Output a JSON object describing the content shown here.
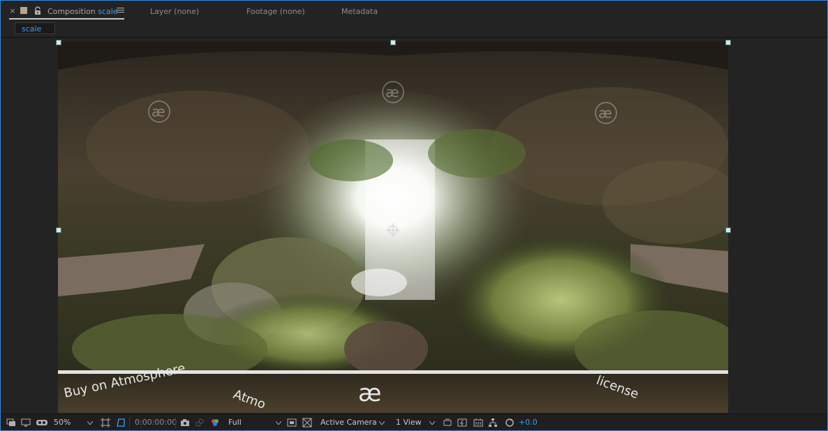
{
  "tabs": {
    "close": "×",
    "composition_label": "Composition",
    "composition_name": "scale",
    "layer": "Layer (none)",
    "footage": "Footage (none)",
    "metadata": "Metadata"
  },
  "flowchart": {
    "chip": "scale"
  },
  "viewer": {
    "watermark_glyph": "æ",
    "bottom_text_left": "Buy on Atmosphere",
    "bottom_text_mid": "Atmo",
    "bottom_text_right": "license"
  },
  "toolbar": {
    "zoom": "50%",
    "timecode": "0:00:00:00",
    "resolution": "Full",
    "camera": "Active Camera",
    "views": "1 View",
    "exposure": "+0.0"
  },
  "colors": {
    "accent": "#3a9ff5",
    "frame_border": "#2d8ceb",
    "panel_bg": "#232323"
  }
}
